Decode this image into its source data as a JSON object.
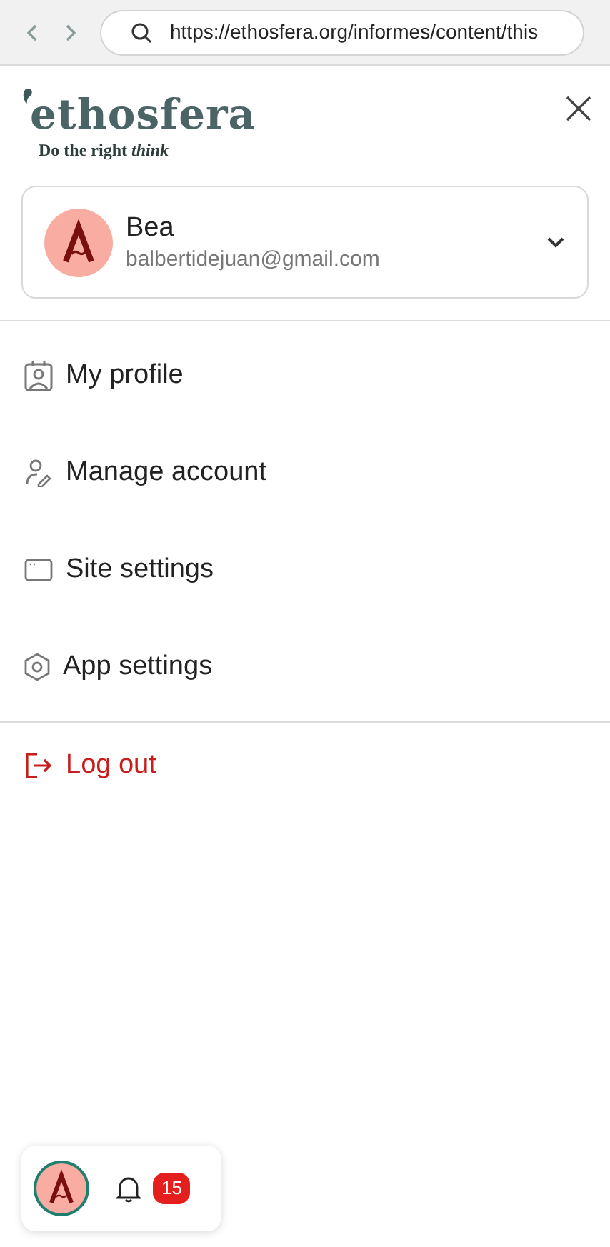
{
  "browser": {
    "url": "https://ethosfera.org/informes/content/this"
  },
  "logo": {
    "name": "ethosfera",
    "tagline": "Do the right *think*"
  },
  "account": {
    "name": "Bea",
    "email": "balbertidejuan@gmail.com",
    "expanded": false
  },
  "menu": [
    {
      "label": "My profile",
      "kind": "profile"
    },
    {
      "label": "Manage account",
      "kind": "account"
    },
    {
      "label": "Site settings",
      "kind": "site"
    },
    {
      "label": "App settings",
      "kind": "app"
    }
  ],
  "logout": {
    "label": "Log out"
  },
  "bottom_bar": {
    "notification_count": "15"
  }
}
